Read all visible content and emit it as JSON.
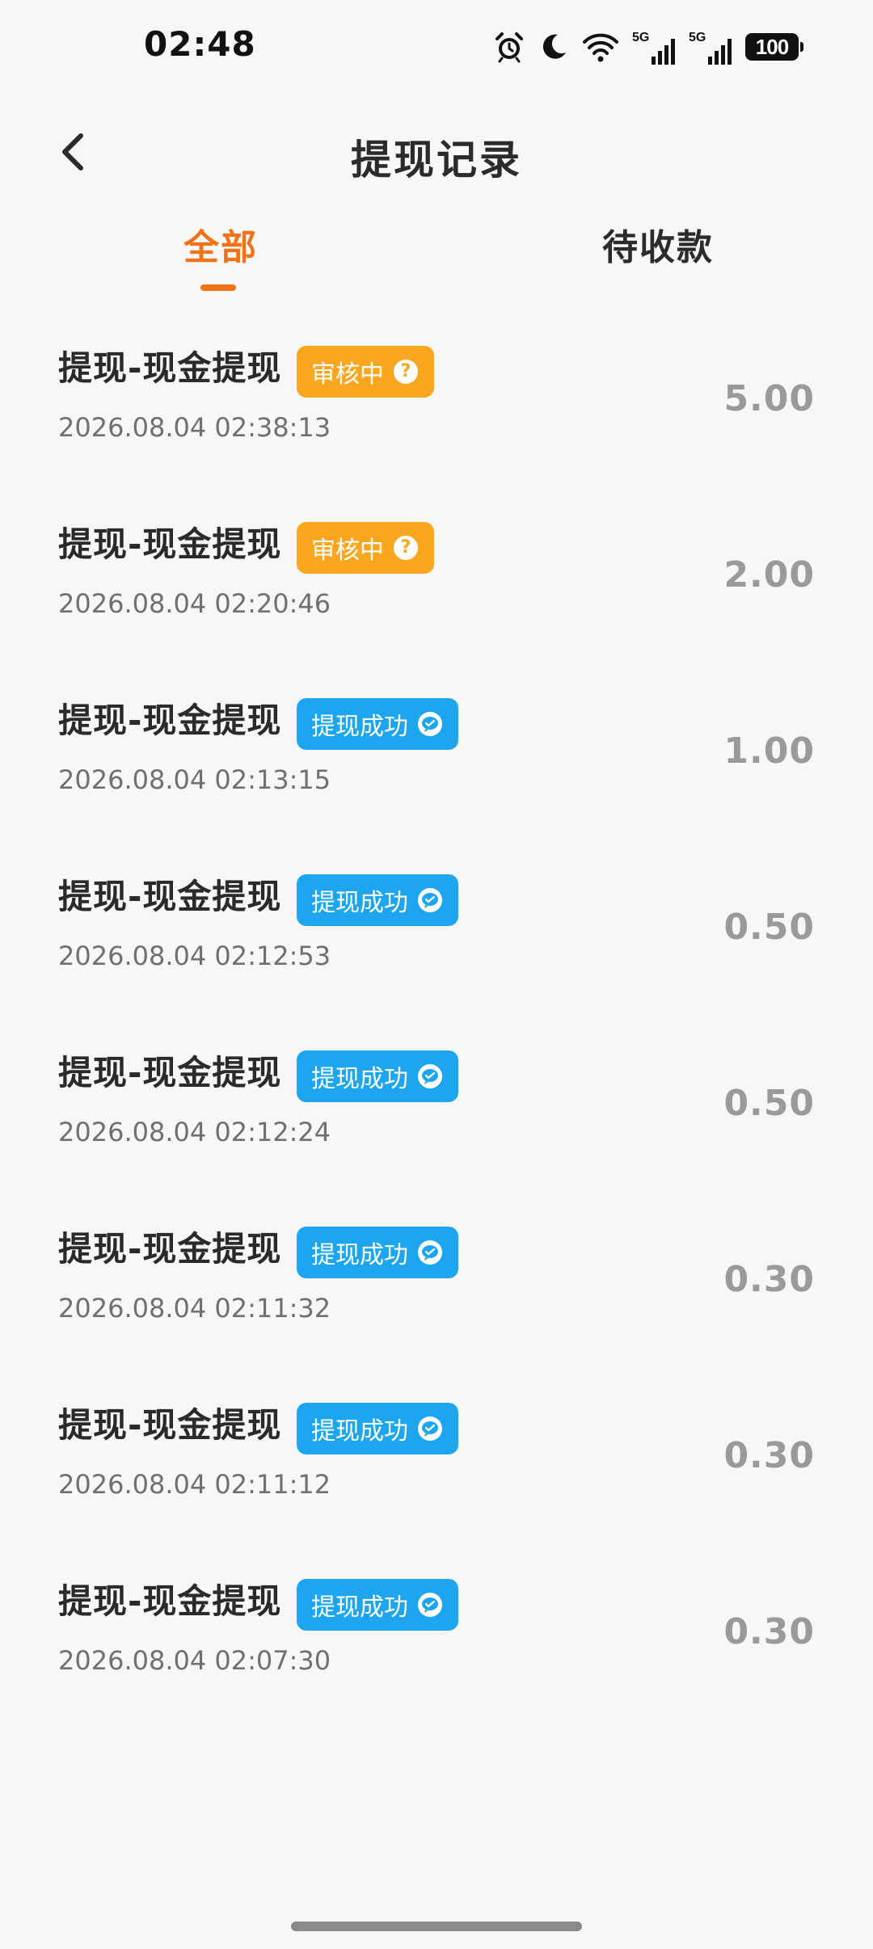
{
  "status_bar": {
    "time": "02:48",
    "icons": [
      "alarm-icon",
      "moon-icon",
      "wifi-icon",
      "signal-icon",
      "signal-icon",
      "battery-icon"
    ],
    "network_label_1": "5G",
    "network_label_2": "5G",
    "battery": "100"
  },
  "header": {
    "back_icon": "chevron-left-icon",
    "title": "提现记录"
  },
  "tabs": [
    {
      "label": "全部",
      "active": true
    },
    {
      "label": "待收款",
      "active": false
    }
  ],
  "records": [
    {
      "title": "提现-现金提现",
      "status": "审核中",
      "status_type": "pending",
      "status_icon": "question-icon",
      "time": "2026.08.04 02:38:13",
      "amount": "5.00"
    },
    {
      "title": "提现-现金提现",
      "status": "审核中",
      "status_type": "pending",
      "status_icon": "question-icon",
      "time": "2026.08.04 02:20:46",
      "amount": "2.00"
    },
    {
      "title": "提现-现金提现",
      "status": "提现成功",
      "status_type": "success",
      "status_icon": "wechat-icon",
      "time": "2026.08.04 02:13:15",
      "amount": "1.00"
    },
    {
      "title": "提现-现金提现",
      "status": "提现成功",
      "status_type": "success",
      "status_icon": "wechat-icon",
      "time": "2026.08.04 02:12:53",
      "amount": "0.50"
    },
    {
      "title": "提现-现金提现",
      "status": "提现成功",
      "status_type": "success",
      "status_icon": "wechat-icon",
      "time": "2026.08.04 02:12:24",
      "amount": "0.50"
    },
    {
      "title": "提现-现金提现",
      "status": "提现成功",
      "status_type": "success",
      "status_icon": "wechat-icon",
      "time": "2026.08.04 02:11:32",
      "amount": "0.30"
    },
    {
      "title": "提现-现金提现",
      "status": "提现成功",
      "status_type": "success",
      "status_icon": "wechat-icon",
      "time": "2026.08.04 02:11:12",
      "amount": "0.30"
    },
    {
      "title": "提现-现金提现",
      "status": "提现成功",
      "status_type": "success",
      "status_icon": "wechat-icon",
      "time": "2026.08.04 02:07:30",
      "amount": "0.30"
    }
  ],
  "colors": {
    "accent": "#f07318",
    "pending_badge": "#fba61f",
    "success_badge": "#1ea5f0",
    "amount_text": "#9a9a9a",
    "background": "#f7f7f7"
  }
}
